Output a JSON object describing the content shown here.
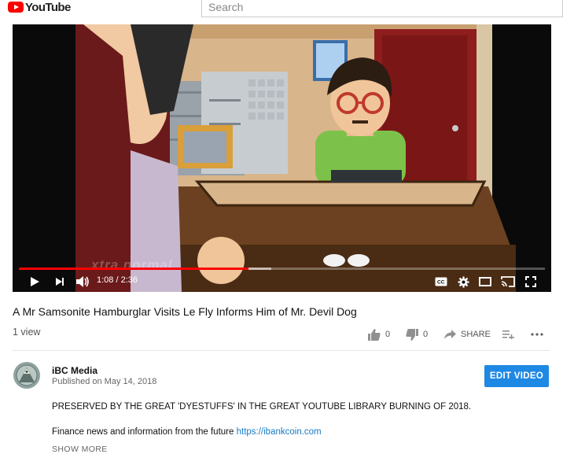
{
  "header": {
    "logo_text": "YouTube",
    "search_placeholder": "Search"
  },
  "player": {
    "time_current": "1:08",
    "time_separator": "/",
    "time_total": "2:36",
    "time_display": "1:08 / 2:36",
    "progress_fraction": 0.436,
    "buffer_fraction": 0.48,
    "watermark": "xtra normal",
    "accent_color": "#ff0000"
  },
  "video": {
    "title": "A Mr Samsonite Hamburglar Visits Le Fly Informs Him of Mr. Devil Dog",
    "views": "1 view",
    "likes": "0",
    "dislikes": "0",
    "share_label": "SHARE"
  },
  "channel": {
    "name": "iBC Media",
    "published": "Published on May 14, 2018",
    "edit_button": "EDIT VIDEO",
    "button_color": "#1e88e5"
  },
  "description": {
    "line1": "PRESERVED BY THE GREAT 'DYESTUFFS' IN THE GREAT YOUTUBE LIBRARY BURNING OF 2018.",
    "line2_text": "Finance news and information from the future",
    "line2_link": "https://ibankcoin.com",
    "show_more": "SHOW MORE"
  },
  "icons": {
    "play": "play-icon",
    "next": "next-icon",
    "volume": "volume-icon",
    "captions": "cc-icon",
    "settings": "gear-icon",
    "miniplayer": "theater-icon",
    "cast": "cast-icon",
    "fullscreen": "fullscreen-icon",
    "like": "thumbs-up-icon",
    "dislike": "thumbs-down-icon",
    "share": "share-icon",
    "add_playlist": "add-to-playlist-icon",
    "more": "more-icon"
  }
}
